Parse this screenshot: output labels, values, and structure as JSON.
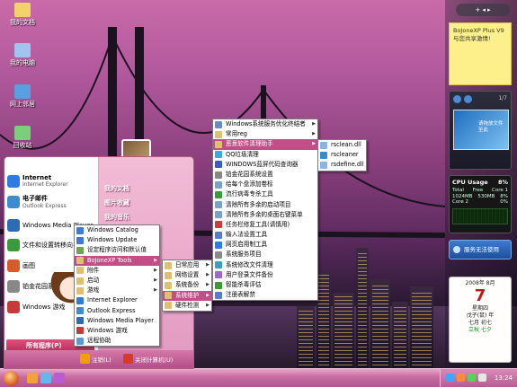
{
  "desktop": {
    "icons": [
      {
        "label": "我的文档",
        "color": "#f2d36a"
      },
      {
        "label": "我的电脑",
        "color": "#9fc4ee"
      },
      {
        "label": "网上邻居",
        "color": "#5aa0e0"
      },
      {
        "label": "回收站",
        "color": "#7ad07a"
      }
    ]
  },
  "sidebar": {
    "top_controls": "+ ◂ ▸",
    "note": {
      "title": "BoJoneXP Plus V9",
      "text": "与您共享激情!"
    },
    "slideshow": {
      "page": "1/7",
      "caption": "请拖放文件至此"
    },
    "cpu": {
      "title": "CPU Usage",
      "percent": "8%",
      "rows": [
        {
          "left": "Total",
          "mid": "Free",
          "right": "Core 1"
        },
        {
          "left": "1024MB",
          "mid": "530MB",
          "right": "8%"
        },
        {
          "left": "Core 2",
          "mid": "",
          "right": "0%"
        }
      ]
    },
    "news_label": "服务无法使用",
    "calendar": {
      "year_month": "2008年 8月",
      "day": "7",
      "weekday": "星期四",
      "ganzhi": "戊子(鼠) 年",
      "lunar": "七月 初七",
      "solar_term": "立秋 七夕"
    }
  },
  "taskbar": {
    "clock": "13:24",
    "quick_launch_colors": [
      "#f3a23b",
      "#63b6ef",
      "#b95bd1"
    ],
    "tray_colors": [
      "#3ea5ff",
      "#ff8a3d",
      "#5ad15a",
      "#e6e6e6"
    ]
  },
  "start_menu": {
    "pinned": [
      {
        "title": "Internet",
        "subtitle": "Internet Explorer",
        "color": "#2f7be0"
      },
      {
        "title": "电子邮件",
        "subtitle": "Outlook Express",
        "color": "#3d8bd1"
      }
    ],
    "recent": [
      {
        "label": "Windows Media Player",
        "color": "#2d6bb7"
      },
      {
        "label": "文件和设置转移向导",
        "color": "#3b9a3b"
      },
      {
        "label": "画图",
        "color": "#d55b2b"
      },
      {
        "label": "铂金花园系统设置",
        "color": "#888888"
      },
      {
        "label": "Windows 游戏",
        "color": "#c83a3a"
      }
    ],
    "right_links": [
      "我的文档",
      "图片收藏",
      "我的音乐"
    ],
    "all_programs": "所有程序(P)",
    "logoff": "注销(L)",
    "shutdown": "关闭计算机(U)"
  },
  "programs_menu": [
    {
      "label": "Windows Catalog",
      "color": "#3b7bd8",
      "sub": false
    },
    {
      "label": "Windows Update",
      "color": "#3b7bd8",
      "sub": false
    },
    {
      "label": "设定程序访问和默认值",
      "color": "#6aa74a",
      "sub": false
    },
    {
      "label": "BoJoneXP Tools",
      "color": "#e0c070",
      "sub": true,
      "highlight": true
    },
    {
      "label": "附件",
      "color": "#e0c070",
      "sub": true
    },
    {
      "label": "启动",
      "color": "#e0c070",
      "sub": true
    },
    {
      "label": "游戏",
      "color": "#e0c070",
      "sub": true
    },
    {
      "label": "Internet Explorer",
      "color": "#2f7be0",
      "sub": false
    },
    {
      "label": "Outlook Express",
      "color": "#3d8bd1",
      "sub": false
    },
    {
      "label": "Windows Media Player",
      "color": "#2d6bb7",
      "sub": false
    },
    {
      "label": "Windows 游戏",
      "color": "#c83a3a",
      "sub": false
    },
    {
      "label": "远程协助",
      "color": "#5a9ad8",
      "sub": false
    }
  ],
  "tools_menu": [
    {
      "label": "日常应用",
      "sub": true
    },
    {
      "label": "网络设置",
      "sub": true
    },
    {
      "label": "系统备份",
      "sub": true
    },
    {
      "label": "系统维护",
      "sub": true,
      "highlight": true
    },
    {
      "label": "硬件检测",
      "sub": true
    }
  ],
  "maintenance_menu": [
    {
      "label": "Windows系统服务优化终结者",
      "color": "#6a8ad0",
      "sub": true
    },
    {
      "label": "常用reg",
      "color": "#e0c070",
      "sub": true
    },
    {
      "label": "恶意软件清理助手",
      "color": "#e0c070",
      "sub": true,
      "highlight": true
    },
    {
      "label": "QQ垃圾清理",
      "color": "#3aa8e8",
      "sub": false
    },
    {
      "label": "WINDOWS蓝屏代码查询器",
      "color": "#3a5ad0",
      "sub": false
    },
    {
      "label": "铂金花园系统设置",
      "color": "#888888",
      "sub": false
    },
    {
      "label": "给每个盘添加卷标",
      "color": "#7aa0d0",
      "sub": false
    },
    {
      "label": "流行病毒专杀工具",
      "color": "#3a9a3a",
      "sub": false
    },
    {
      "label": "清除所有多余的启动项目",
      "color": "#7aa0d0",
      "sub": false
    },
    {
      "label": "清除所有多余的桌面右键菜单",
      "color": "#7aa0d0",
      "sub": false
    },
    {
      "label": "任务栏修复工具(请慎用)",
      "color": "#d03a3a",
      "sub": false
    },
    {
      "label": "输入法设置工具",
      "color": "#5a7ad0",
      "sub": false
    },
    {
      "label": "网页启用制工具",
      "color": "#2f7be0",
      "sub": false
    },
    {
      "label": "系统服务项目",
      "color": "#8a8a8a",
      "sub": false
    },
    {
      "label": "系统修改文件清理",
      "color": "#3aa0c0",
      "sub": false
    },
    {
      "label": "用户登录文件备份",
      "color": "#9a6ad0",
      "sub": false
    },
    {
      "label": "智能杀毒评估",
      "color": "#3a9a3a",
      "sub": false
    },
    {
      "label": "注册表解禁",
      "color": "#5a7ad0",
      "sub": false
    }
  ],
  "cleaner_menu": [
    {
      "label": "rsclean.dll",
      "color": "#8ab4e8"
    },
    {
      "label": "rscleaner",
      "color": "#3a8ad0"
    },
    {
      "label": "rsdefine.dll",
      "color": "#8ab4e8"
    }
  ]
}
